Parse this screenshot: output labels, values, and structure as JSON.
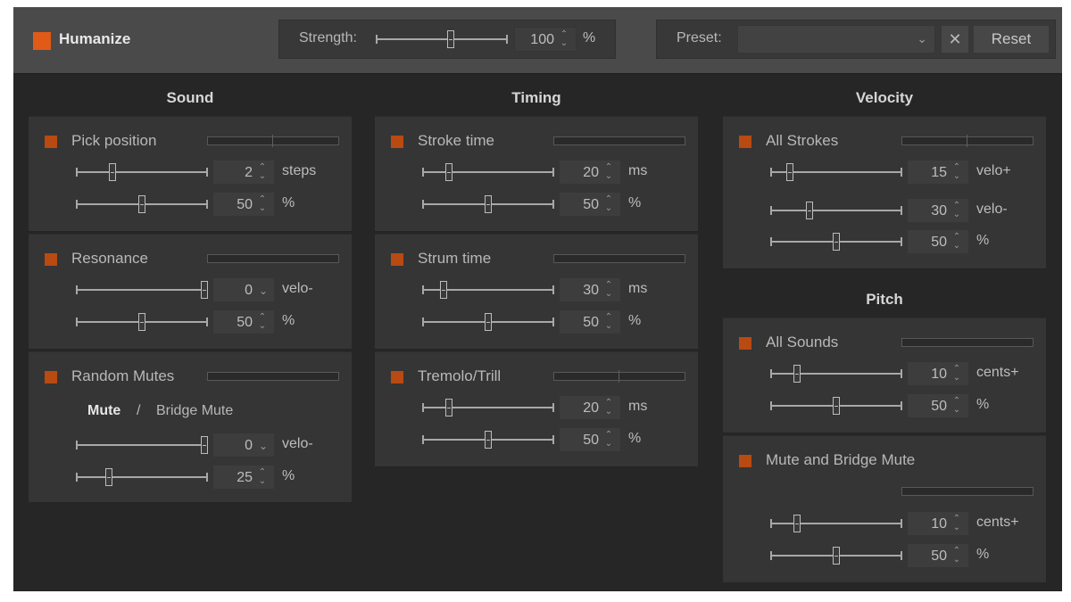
{
  "header": {
    "title": "Humanize",
    "strength_label": "Strength:",
    "strength_value": "100",
    "strength_unit": "%",
    "strength_level": 0.57,
    "preset_label": "Preset:",
    "preset_value": "",
    "reset_label": "Reset",
    "clear_icon": "close-icon"
  },
  "colors": {
    "accent": "#e15a17",
    "toggle": "#b84a12",
    "panel": "#353535",
    "background": "#262626"
  },
  "sections": {
    "sound": "Sound",
    "timing": "Timing",
    "velocity": "Velocity",
    "pitch": "Pitch"
  },
  "sound": {
    "pick_position": {
      "name": "Pick position",
      "row1": {
        "value": "2",
        "unit": "steps"
      },
      "row2": {
        "value": "50",
        "unit": "%"
      }
    },
    "resonance": {
      "name": "Resonance",
      "row1": {
        "value": "0",
        "unit": "velo-"
      },
      "row2": {
        "value": "50",
        "unit": "%"
      }
    },
    "random_mutes": {
      "name": "Random Mutes",
      "mute_label": "Mute",
      "separator": "/",
      "bridge_mute_label": "Bridge Mute",
      "row1": {
        "value": "0",
        "unit": "velo-"
      },
      "row2": {
        "value": "25",
        "unit": "%"
      }
    }
  },
  "timing": {
    "stroke_time": {
      "name": "Stroke time",
      "row1": {
        "value": "20",
        "unit": "ms"
      },
      "row2": {
        "value": "50",
        "unit": "%"
      }
    },
    "strum_time": {
      "name": "Strum time",
      "row1": {
        "value": "30",
        "unit": "ms"
      },
      "row2": {
        "value": "50",
        "unit": "%"
      }
    },
    "tremolo_trill": {
      "name": "Tremolo/Trill",
      "row1": {
        "value": "20",
        "unit": "ms"
      },
      "row2": {
        "value": "50",
        "unit": "%"
      }
    }
  },
  "velocity": {
    "all_strokes": {
      "name": "All Strokes",
      "row1": {
        "value": "15",
        "unit": "velo+"
      },
      "row2": {
        "value": "30",
        "unit": "velo-"
      },
      "row3": {
        "value": "50",
        "unit": "%"
      }
    }
  },
  "pitch": {
    "all_sounds": {
      "name": "All Sounds",
      "row1": {
        "value": "10",
        "unit": "cents+"
      },
      "row2": {
        "value": "50",
        "unit": "%"
      }
    },
    "mute_bridge": {
      "name": "Mute and Bridge Mute",
      "row1": {
        "value": "10",
        "unit": "cents+"
      },
      "row2": {
        "value": "50",
        "unit": "%"
      }
    }
  }
}
